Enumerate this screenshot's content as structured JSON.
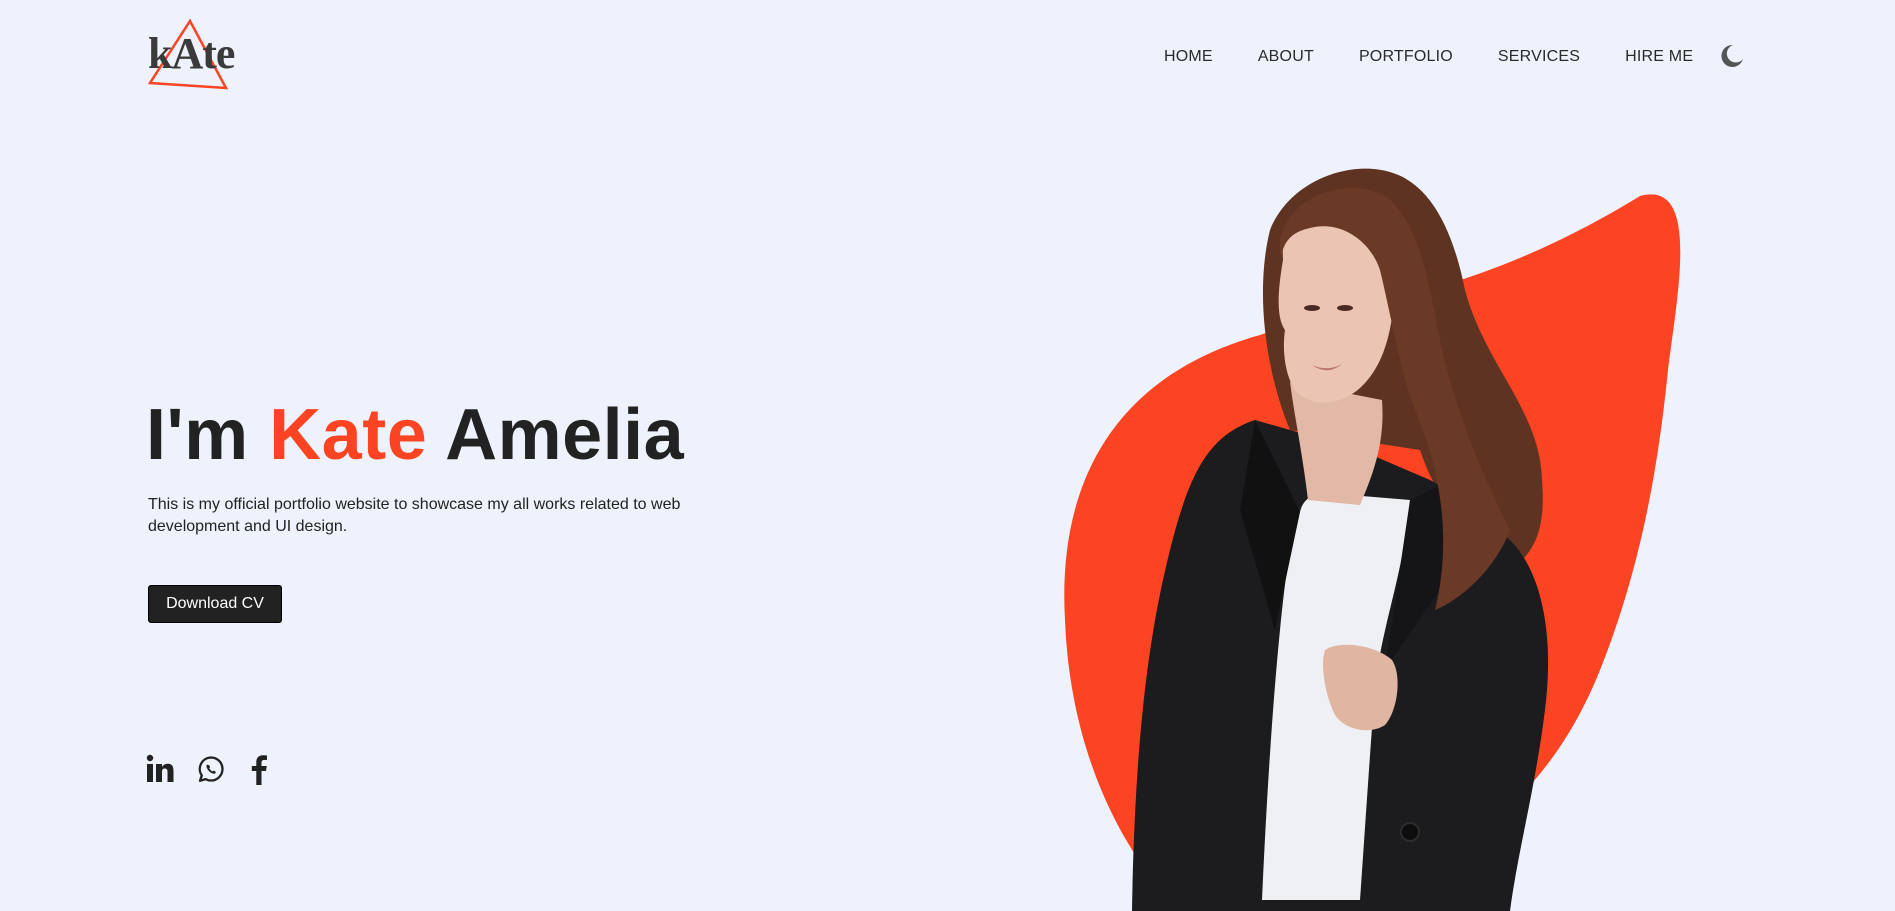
{
  "brand": {
    "logo_text": "kAte"
  },
  "nav": {
    "items": [
      {
        "label": "HOME"
      },
      {
        "label": "ABOUT"
      },
      {
        "label": "PORTFOLIO"
      },
      {
        "label": "SERVICES"
      },
      {
        "label": "HIRE ME"
      }
    ],
    "theme_icon": "moon-icon"
  },
  "hero": {
    "greeting": "I'm",
    "first_name": "Kate",
    "last_name": "Amelia",
    "description": "This is my official portfolio website to showcase my all works related to web development and UI design.",
    "cta_label": "Download CV"
  },
  "social": [
    {
      "icon": "linkedin-icon"
    },
    {
      "icon": "whatsapp-icon"
    },
    {
      "icon": "facebook-icon"
    }
  ],
  "colors": {
    "accent": "#fd4422",
    "background": "#eef2fc",
    "text": "#222222",
    "button_bg": "#222222",
    "coat": "#1c1c1e",
    "hair": "#6b3a27",
    "skin": "#e8c1b0"
  }
}
